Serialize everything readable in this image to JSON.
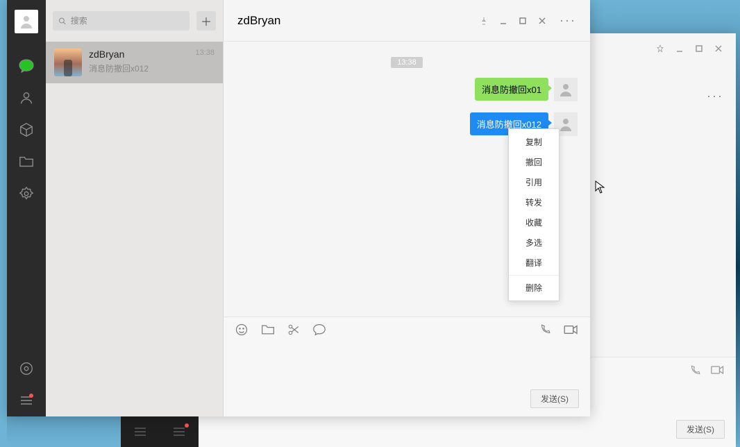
{
  "search": {
    "placeholder": "搜索"
  },
  "sidebar_icons": {
    "chat": "chat-bubble-icon",
    "contacts": "contacts-icon",
    "favorites": "cube-icon",
    "files": "folder-icon",
    "miniapp": "settings-gear-icon",
    "music": "music-disc-icon",
    "menu": "menu-icon"
  },
  "conversations": [
    {
      "name": "zdBryan",
      "time": "13:38",
      "preview": "消息防撤回x012"
    }
  ],
  "chat": {
    "title": "zdBryan",
    "timestamp": "13:38",
    "messages": [
      {
        "text": "消息防撤回x01",
        "selected": false
      },
      {
        "text": "消息防撤回x012",
        "selected": true
      }
    ]
  },
  "context_menu": {
    "items": [
      "复制",
      "撤回",
      "引用",
      "转发",
      "收藏",
      "多选",
      "翻译"
    ],
    "danger": "删除"
  },
  "send_label": "发送(S)",
  "bg_send_label": "发送(S)",
  "colors": {
    "accent_green": "#8fe05c",
    "select_blue": "#1e8bf5"
  }
}
